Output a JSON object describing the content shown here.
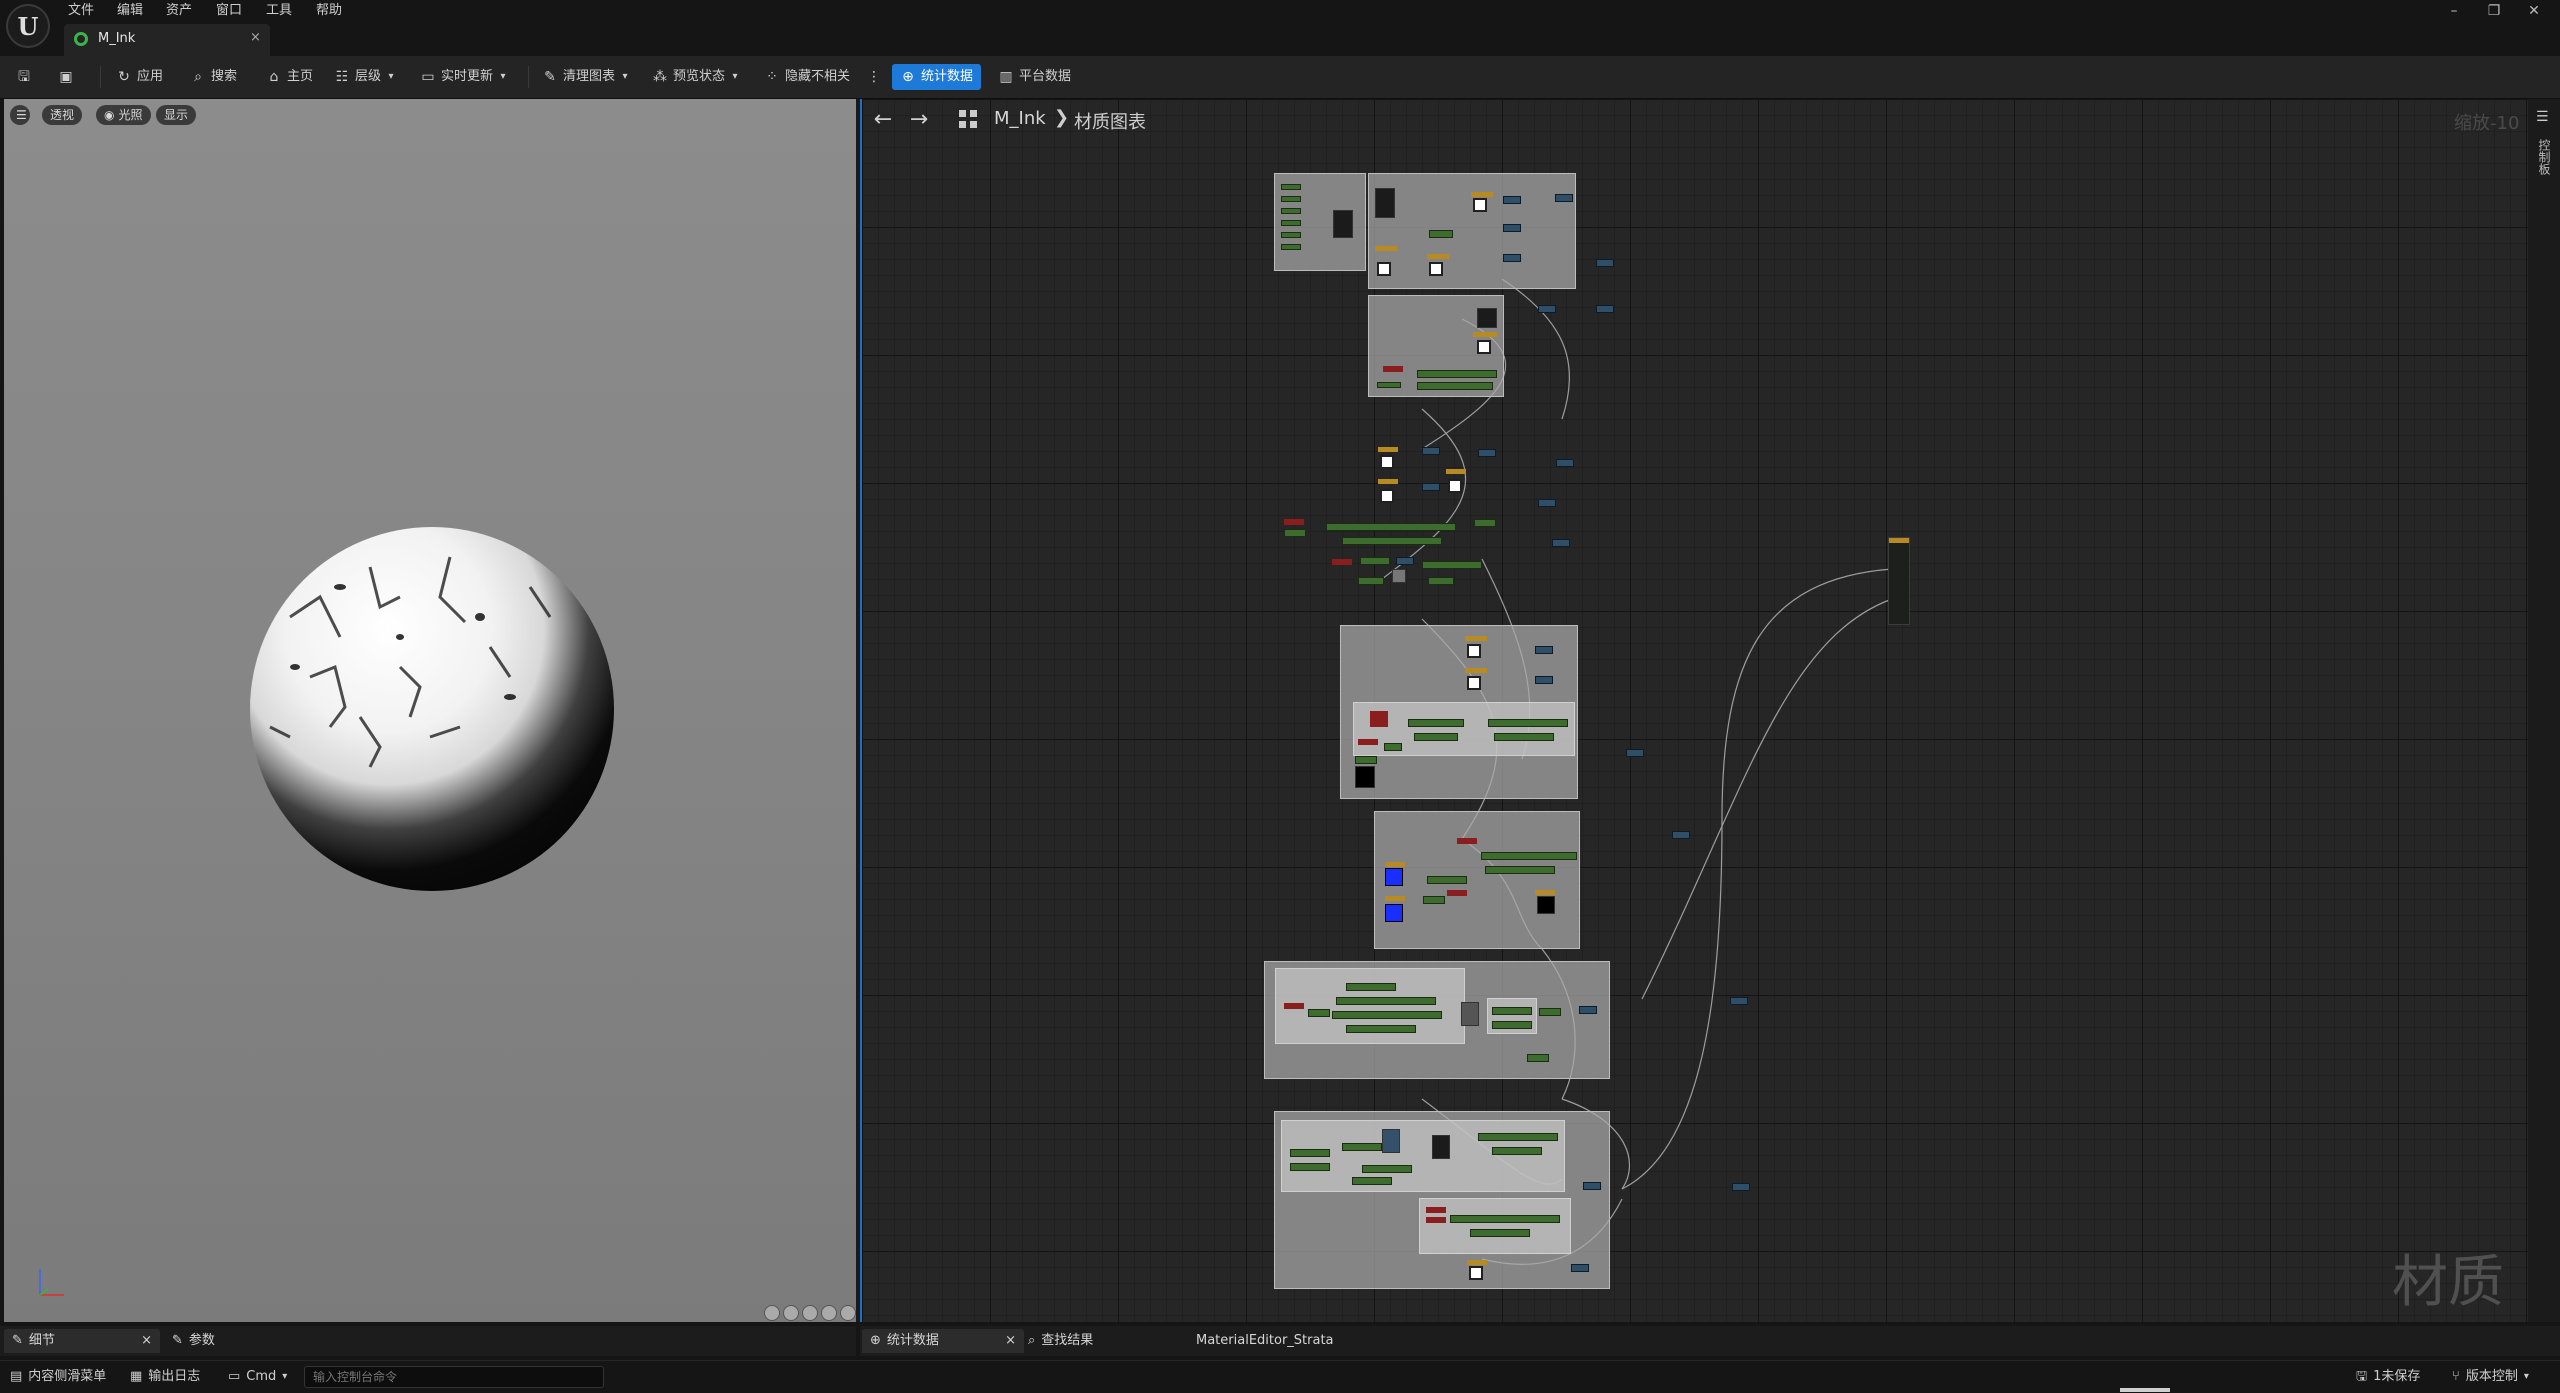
{
  "app": {
    "logo": "U"
  },
  "menu": [
    "文件",
    "编辑",
    "资产",
    "窗口",
    "工具",
    "帮助"
  ],
  "tab": {
    "title": "M_Ink",
    "close": "×"
  },
  "window_controls": [
    "–",
    "❐",
    "✕"
  ],
  "toolbar": {
    "apply": "应用",
    "search": "搜索",
    "home": "主页",
    "hierarchy": "层级",
    "live_update": "实时更新",
    "clean_graph": "清理图表",
    "preview_state": "预览状态",
    "hide_unrelated": "隐藏不相关",
    "stats": "统计数据",
    "platform_stats": "平台数据"
  },
  "viewport": {
    "perspective": "透视",
    "lit": "光照",
    "show": "显示"
  },
  "graph": {
    "breadcrumb_material": "M_Ink",
    "breadcrumb_sep": "❯",
    "breadcrumb_graph": "材质图表",
    "zoom": "缩放-10",
    "watermark": "材质",
    "side_panel": "控制板"
  },
  "bottom_left": {
    "details_tab": "细节",
    "details_close": "×",
    "params_tab": "参数"
  },
  "bottom_right": {
    "stats_tab": "统计数据",
    "stats_close": "×",
    "find_tab": "查找结果",
    "strata_label": "MaterialEditor_Strata"
  },
  "statusbar": {
    "content_drawer": "内容侧滑菜单",
    "output_log": "输出日志",
    "cmd": "Cmd",
    "cmd_placeholder": "输入控制台命令",
    "unsaved": "1未保存",
    "source_control": "版本控制"
  },
  "colors": {
    "accent": "#1d7ad8",
    "material_icon": "#3cb44b",
    "node_green": "#3e6b2e",
    "node_texture_head": "#b88a24"
  }
}
